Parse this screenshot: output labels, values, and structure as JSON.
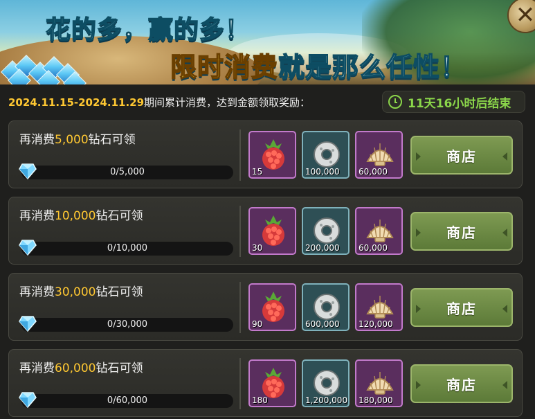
{
  "banner": {
    "title_line1": "花的多，赢的多！",
    "title_line2_highlight": "限时消费",
    "title_line2_rest": "就是那么任性！"
  },
  "close_button": {
    "label": "✕"
  },
  "info": {
    "period_dates": "2024.11.15-2024.11.29",
    "period_text": "期间累计消费，达到金额领取奖励：",
    "timer_text": "11天16小时后结束"
  },
  "tiers": [
    {
      "label_prefix": "再消费",
      "amount": "5,000",
      "label_suffix": "钻石可领",
      "progress_text": "0/5,000",
      "progress": 0,
      "rewards": [
        "15",
        "100,000",
        "60,000"
      ],
      "button": "商店"
    },
    {
      "label_prefix": "再消费",
      "amount": "10,000",
      "label_suffix": "钻石可领",
      "progress_text": "0/10,000",
      "progress": 0,
      "rewards": [
        "30",
        "200,000",
        "60,000"
      ],
      "button": "商店"
    },
    {
      "label_prefix": "再消费",
      "amount": "30,000",
      "label_suffix": "钻石可领",
      "progress_text": "0/30,000",
      "progress": 0,
      "rewards": [
        "90",
        "600,000",
        "120,000"
      ],
      "button": "商店"
    },
    {
      "label_prefix": "再消费",
      "amount": "60,000",
      "label_suffix": "钻石可领",
      "progress_text": "0/60,000",
      "progress": 0,
      "rewards": [
        "180",
        "1,200,000",
        "180,000"
      ],
      "button": "商店"
    }
  ],
  "icons": {
    "reward_1": "raspberry-icon",
    "reward_2": "stone-ring-icon",
    "reward_3": "seashell-icon",
    "progress": "diamond-icon",
    "timer": "clock-icon"
  },
  "colors": {
    "accent_gold": "#ffc832",
    "timer_green": "#8bd64a",
    "button_green": "#6b8a44"
  }
}
